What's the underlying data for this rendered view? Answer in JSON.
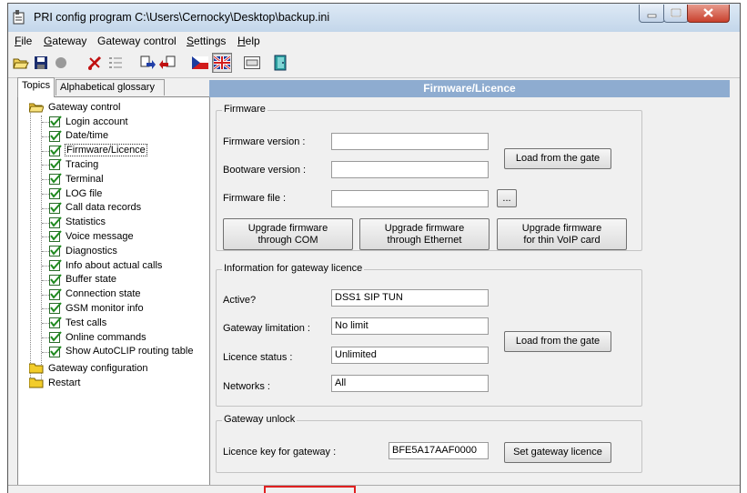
{
  "window": {
    "title": "PRI config program C:\\Users\\Cernocky\\Desktop\\backup.ini",
    "controls": [
      "minimize-icon",
      "maximize-icon",
      "close-icon"
    ]
  },
  "menu": [
    {
      "label": "File",
      "mnemonic": "F",
      "rest": "ile"
    },
    {
      "label": "Gateway",
      "mnemonic": "G",
      "rest": "ateway"
    },
    {
      "label": "Gateway control",
      "mnemonic": "",
      "rest": "Gateway control"
    },
    {
      "label": "Settings",
      "mnemonic": "S",
      "rest": "ettings"
    },
    {
      "label": "Help",
      "mnemonic": "H",
      "rest": "elp"
    }
  ],
  "toolbar": {
    "icons": [
      "open-folder-icon",
      "save-icon",
      "record-icon",
      "disconnect-icon",
      "list-icon",
      "upload-icon",
      "download-icon",
      "czech-flag-icon",
      "uk-flag-icon",
      "keyboard-icon",
      "exit-door-icon"
    ]
  },
  "tabs": {
    "topics": "Topics",
    "glossary": "Alphabetical glossary"
  },
  "tree": {
    "root1": "Gateway control",
    "items": [
      "Login account",
      "Date/time",
      "Firmware/Licence",
      "Tracing",
      "Terminal",
      "LOG file",
      "Call data records",
      "Statistics",
      "Voice message",
      "Diagnostics",
      "Info about actual calls",
      "Buffer state",
      "Connection state",
      "GSM monitor info",
      "Test calls",
      "Online commands",
      "Show AutoCLIP routing table"
    ],
    "selected": "Firmware/Licence",
    "root2": "Gateway configuration",
    "root3": "Restart"
  },
  "content": {
    "header": "Firmware/Licence",
    "firmware": {
      "legend": "Firmware",
      "version_label": "Firmware version :",
      "version_value": "",
      "bootware_label": "Bootware version :",
      "bootware_value": "",
      "file_label": "Firmware file :",
      "file_value": "",
      "browse_label": "...",
      "load_button": "Load from the gate",
      "upgrade_com_line1": "Upgrade firmware",
      "upgrade_com_line2": "through COM",
      "upgrade_eth_line1": "Upgrade firmware",
      "upgrade_eth_line2": "through Ethernet",
      "upgrade_voip_line1": "Upgrade firmware",
      "upgrade_voip_line2": "for thin VoIP card"
    },
    "licence": {
      "legend": "Information for gateway licence",
      "active_label": "Active?",
      "active_value": "DSS1 SIP TUN",
      "limitation_label": "Gateway limitation :",
      "limitation_value": "No limit",
      "status_label": "Licence status :",
      "status_value": "Unlimited",
      "networks_label": "Networks :",
      "networks_value": "All",
      "load_button": "Load from the gate"
    },
    "unlock": {
      "legend": "Gateway unlock",
      "key_label": "Licence key for gateway :",
      "key_value": "BFE5A17AAF0000",
      "set_button": "Set gateway licence"
    }
  }
}
